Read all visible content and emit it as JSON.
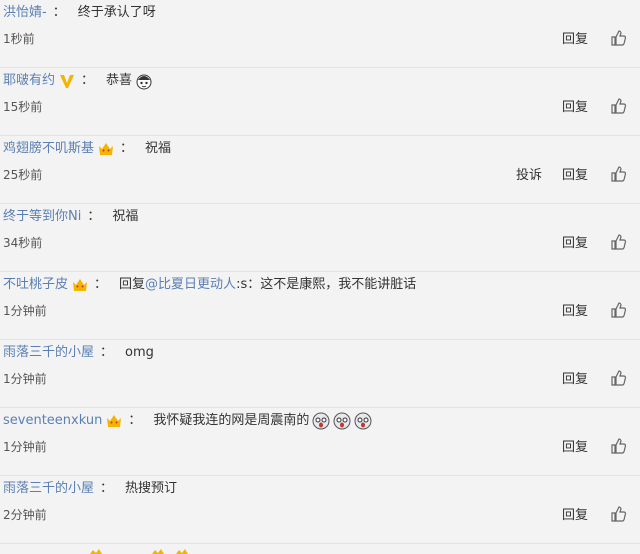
{
  "comments": [
    {
      "user": "洪怡婧-",
      "separator": "：",
      "text": "终于承认了呀",
      "time": "1秒前",
      "reply": "回复"
    },
    {
      "user": "耶啵有约",
      "separator": "：",
      "text": "恭喜",
      "time": "15秒前",
      "reply": "回复"
    },
    {
      "user": "鸡翅膀不叽斯基",
      "separator": "：",
      "text": "祝福",
      "time": "25秒前",
      "report": "投诉",
      "reply": "回复"
    },
    {
      "user": "终于等到你Ni",
      "separator": "：",
      "text": "祝福",
      "time": "34秒前",
      "reply": "回复"
    },
    {
      "user": "不吐桃子皮",
      "separator": "：",
      "text_prefix": "回复",
      "mention": "@比夏日更动人",
      "text": ":s：这不是康熙，我不能讲脏话",
      "time": "1分钟前",
      "reply": "回复"
    },
    {
      "user": "雨落三千的小屋",
      "separator": "：",
      "text": "omg",
      "time": "1分钟前",
      "reply": "回复"
    },
    {
      "user": "seventeenxkun",
      "separator": "：",
      "text": "我怀疑我连的网是周震南的",
      "time": "1分钟前",
      "reply": "回复"
    },
    {
      "user": "雨落三千的小屋",
      "separator": "：",
      "text": "热搜预订",
      "time": "2分钟前",
      "reply": "回复"
    }
  ],
  "colors": {
    "username": "#5b7fb3",
    "background": "#f3f3f3",
    "divider": "#e2e2e2",
    "badge": "#f4b400"
  },
  "icons": {
    "like": "thumbs-up-icon",
    "vip": "v-badge-icon",
    "crown": "crown-icon",
    "emoji": "face-emoji-icon"
  }
}
